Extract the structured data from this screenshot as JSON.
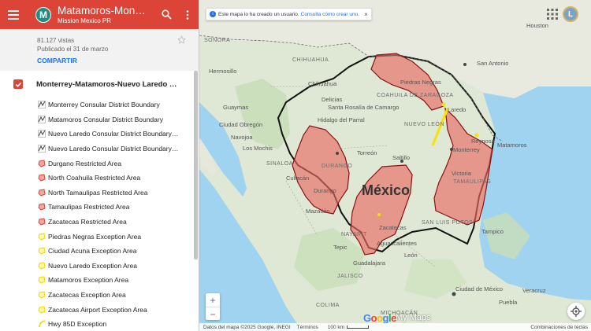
{
  "header": {
    "title": "Matamoros-Monterrey-Nuevo Laredo",
    "subtitle": "Mission Mexico PR",
    "avatar_letter": "M",
    "color": "#db4437"
  },
  "meta": {
    "views": "81.127 vistas",
    "published": "Publicado el 31 de marzo",
    "share_label": "COMPARTIR"
  },
  "layer": {
    "title": "Monterrey-Matamoros-Nuevo Laredo Co...",
    "checked": true
  },
  "items": [
    {
      "label": "Monterrey Consular District Boundary",
      "icon": "polyline-icon"
    },
    {
      "label": "Matamoros Consular District Boundary",
      "icon": "polyline-icon"
    },
    {
      "label": "Nuevo Laredo Consular District Boundary (C...",
      "icon": "polyline-icon"
    },
    {
      "label": "Nuevo Laredo Consular District Boundary (T...",
      "icon": "polyline-icon"
    },
    {
      "label": "Durgano Restricted Area",
      "icon": "polygon-red-icon"
    },
    {
      "label": "North Coahuila Restricted Area",
      "icon": "polygon-red-icon"
    },
    {
      "label": "North Tamaulipas Restricted Area",
      "icon": "polygon-red-icon"
    },
    {
      "label": "Tamaulipas Restricted Area",
      "icon": "polygon-red-icon"
    },
    {
      "label": "Zacatecas Restricted Area",
      "icon": "polygon-red-icon"
    },
    {
      "label": "Piedras Negras Exception Area",
      "icon": "polygon-yellow-icon"
    },
    {
      "label": "Ciudad Acuna Exception Area",
      "icon": "polygon-yellow-icon"
    },
    {
      "label": "Nuevo Laredo Exception Area",
      "icon": "polygon-yellow-icon"
    },
    {
      "label": "Matamoros Exception Area",
      "icon": "polygon-yellow-icon"
    },
    {
      "label": "Zacatecas Exception Area",
      "icon": "polygon-yellow-icon"
    },
    {
      "label": "Zacatecas Airport Exception Area",
      "icon": "polygon-yellow-icon"
    },
    {
      "label": "Hwy 85D Exception",
      "icon": "line-yellow-icon"
    }
  ],
  "map": {
    "notice_text": "Este mapa lo ha creado un usuario.",
    "notice_link": "Consulta cómo crear uno.",
    "profile_letter": "L",
    "country": "México",
    "labels": {
      "sonora": "SONORA",
      "chihuahua": "CHIHUAHUA",
      "coahuila": "COAHUILA DE ZARAGOZA",
      "durango_state": "DURANGO",
      "sinaloa": "SINALOA",
      "nayarit": "NAYARIT",
      "slp": "SAN LUIS POTOSÍ",
      "jalisco": "JALISCO",
      "tamaulipas": "TAMAULIPAS",
      "san_antonio": "San Antonio",
      "hermosillo": "Hermosillo",
      "monterrey": "Monterrey",
      "saltillo": "Saltillo",
      "torreon": "Torreón",
      "durango": "Durango",
      "laredo": "Laredo",
      "nuevo_leon": "NUEVO LEÓN",
      "tampico": "Tampico",
      "cdmx": "Ciudad de México",
      "mazatlan": "Mazatlán",
      "guadalajara": "Guadalajara",
      "piedras_negras": "Piedras Negras",
      "reynosa": "Reynosa",
      "houston": "Houston",
      "guaymas": "Guaymas",
      "culiacan": "Culiacán",
      "tepic": "Tepic",
      "colima": "COLIMA",
      "michoacan": "MICHOACÁN",
      "zacatecas": "Zacatecas",
      "aguascalientes": "Aguascalientes",
      "leon": "León",
      "puebla": "Puebla",
      "veracruz": "Veracruz",
      "hidalgo_parral": "Hidalgo del Parral",
      "santa_rosalia": "Santa Rosalía de Camargo",
      "delicias": "Delicias",
      "los_mochis": "Los Mochis",
      "ciudad_obregon": "Ciudad Obregón",
      "navojoa": "Navojoa",
      "chihuahua_city": "Chihuahua",
      "victoria": "Victoria",
      "matamoros": "Matamoros"
    },
    "footer_data": "Datos del mapa ©2025 Google, INEGI",
    "footer_terms": "Términos",
    "footer_scale": "100 km",
    "footer_keys": "Combinaciones de teclas",
    "google": "Google",
    "mymaps": "My Maps"
  }
}
